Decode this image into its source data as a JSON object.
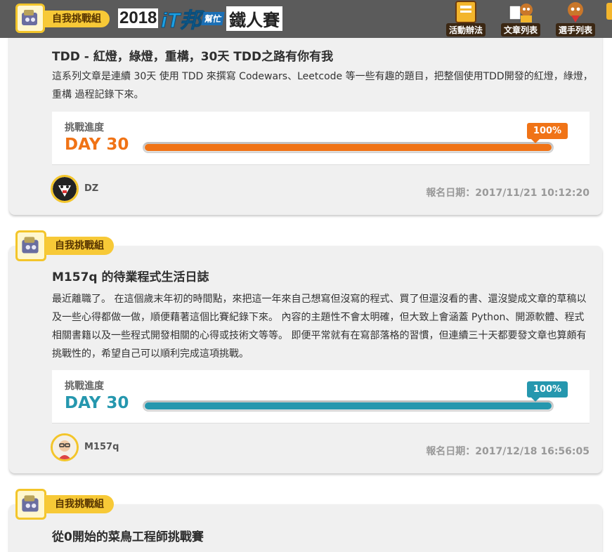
{
  "header": {
    "badge_label": "自我挑戰組",
    "logo": {
      "year": "2018",
      "it": "iT",
      "bang": "邦",
      "help": "幫忙",
      "iron": "鐵人賽"
    },
    "nav": [
      {
        "label": "活動辦法",
        "icon": "notebook-icon"
      },
      {
        "label": "文章列表",
        "icon": "dog-reading-icon"
      },
      {
        "label": "選手列表",
        "icon": "dog-player-icon"
      }
    ]
  },
  "cards": [
    {
      "group_label": "自我挑戰組",
      "title": "TDD - 紅燈，綠燈，重構，30天 TDD之路有你有我",
      "description": "這系列文章是連續 30天 使用 TDD 來撰寫 Codewars、Leetcode 等一些有趣的題目，把整個使用TDD開發的紅燈，綠燈，重構 過程記錄下來。",
      "progress_label": "挑戰進度",
      "day": "DAY 30",
      "percent_text": "100%",
      "percent": 100,
      "color": "#f07316",
      "author": "DZ",
      "reg_date": "報名日期：2017/11/21 10:12:20"
    },
    {
      "group_label": "自我挑戰組",
      "title": "M157q 的待業程式生活日誌",
      "description": "最近離職了。 在這個歲末年初的時間點，來把這一年來自己想寫但沒寫的程式、買了但還沒看的書、還沒變成文章的草稿以及一些心得都做一做，順便藉著這個比賽紀錄下來。 內容的主題性不會太明確，但大致上會涵蓋 Python、開源軟體、程式相關書籍以及一些程式開發相關的心得或技術文等等。 即便平常就有在寫部落格的習慣，但連續三十天都要發文章也算頗有挑戰性的，希望自己可以順利完成這項挑戰。",
      "progress_label": "挑戰進度",
      "day": "DAY 30",
      "percent_text": "100%",
      "percent": 100,
      "color": "#2597ae",
      "author": "M157q",
      "reg_date": "報名日期：2017/12/18 16:56:05"
    },
    {
      "group_label": "自我挑戰組",
      "title": "從0開始的菜鳥工程師挑戰賽"
    }
  ]
}
